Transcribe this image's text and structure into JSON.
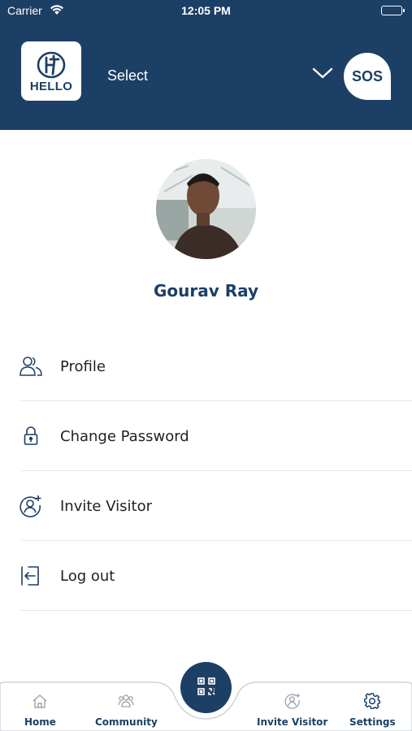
{
  "status_bar": {
    "carrier": "Carrier",
    "time": "12:05 PM"
  },
  "header": {
    "logo_text": "HELLO",
    "select_label": "Select",
    "sos_label": "SOS"
  },
  "profile": {
    "name": "Gourav Ray"
  },
  "menu": {
    "items": [
      {
        "label": "Profile",
        "icon": "users-icon"
      },
      {
        "label": "Change Password",
        "icon": "lock-icon"
      },
      {
        "label": "Invite Visitor",
        "icon": "user-plus-icon"
      },
      {
        "label": "Log out",
        "icon": "logout-icon"
      }
    ]
  },
  "tabbar": {
    "tabs": [
      {
        "label": "Home",
        "icon": "home-icon"
      },
      {
        "label": "Community",
        "icon": "community-icon"
      },
      {
        "label": "Invite Visitor",
        "icon": "invite-visitor-icon"
      },
      {
        "label": "Settings",
        "icon": "settings-icon"
      }
    ],
    "center_icon": "qr-code-icon"
  },
  "colors": {
    "primary": "#1c3f66",
    "background": "#ffffff",
    "divider": "#e6e6e6",
    "tab_icon": "#9aa3ad"
  }
}
